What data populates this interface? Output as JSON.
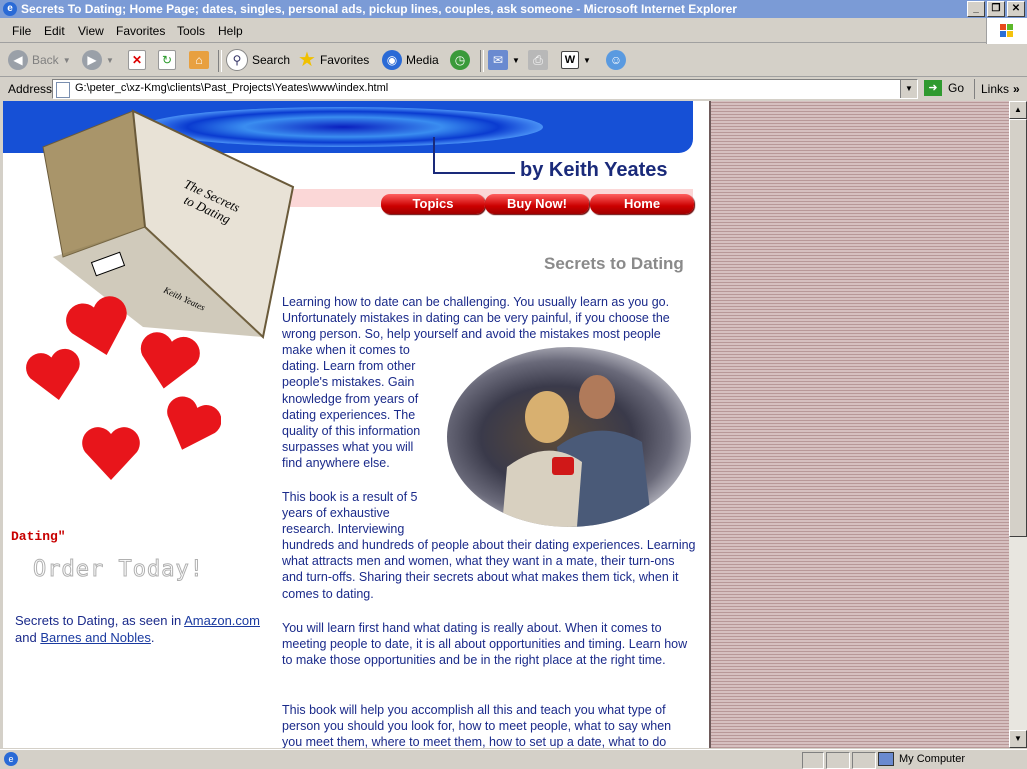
{
  "window": {
    "title": "Secrets To Dating; Home Page; dates, singles, personal ads, pickup lines, couples, ask someone  - Microsoft Internet Explorer",
    "min_label": "_",
    "max_label": "❐",
    "close_label": "✕"
  },
  "menu": [
    "File",
    "Edit",
    "View",
    "Favorites",
    "Tools",
    "Help"
  ],
  "toolbar": {
    "back": "Back",
    "search": "Search",
    "favorites": "Favorites",
    "media": "Media"
  },
  "address": {
    "label": "Address",
    "url": "G:\\peter_c\\xz-Kmg\\clients\\Past_Projects\\Yeates\\www\\index.html",
    "go": "Go",
    "links": "Links"
  },
  "page": {
    "byline": "by Keith Yeates",
    "nav": [
      "Topics",
      "Buy Now!",
      "Home"
    ],
    "heading": "Secrets to Dating",
    "book": {
      "title_line1": "The Secrets",
      "title_line2": "to Dating",
      "author": "Keith Yeates"
    },
    "dating_red": "Dating\"",
    "order_today": "Order Today!",
    "amazon": {
      "prefix": "Secrets to Dating, as seen in ",
      "amazon_link": "Amazon.com",
      "and": "and ",
      "bn_link": "Barnes and Nobles",
      "suffix": "."
    },
    "para1_top": "Learning how to date can be challenging. You usually learn as you go. Unfortunately mistakes in dating can be very painful, if you choose the wrong person. So, help yourself and avoid the mistakes most people",
    "para1_side": "make when it comes to dating. Learn from other people's mistakes. Gain knowledge from years of dating experiences. The quality of this information surpasses what you will find anywhere else.",
    "para2_side": "This book is a result of 5 years of exhaustive research. Interviewing",
    "para2_rest": "hundreds and hundreds of people about their dating experiences. Learning what attracts men and women, what they want in a mate, their turn-ons and turn-offs. Sharing their secrets about what makes them tick, when it comes to dating.",
    "para3": "You will learn first hand what dating is really about. When it comes to meeting people to date, it is all about opportunities and timing. Learn how to make those opportunities and be in the right place at the right time.",
    "para4": "This book will help you accomplish all this and teach you what type of person you should you look for, how to meet people, what to say when you meet them, where to meet them, how to set up a date, what to do"
  },
  "status": {
    "zone": "My Computer"
  }
}
